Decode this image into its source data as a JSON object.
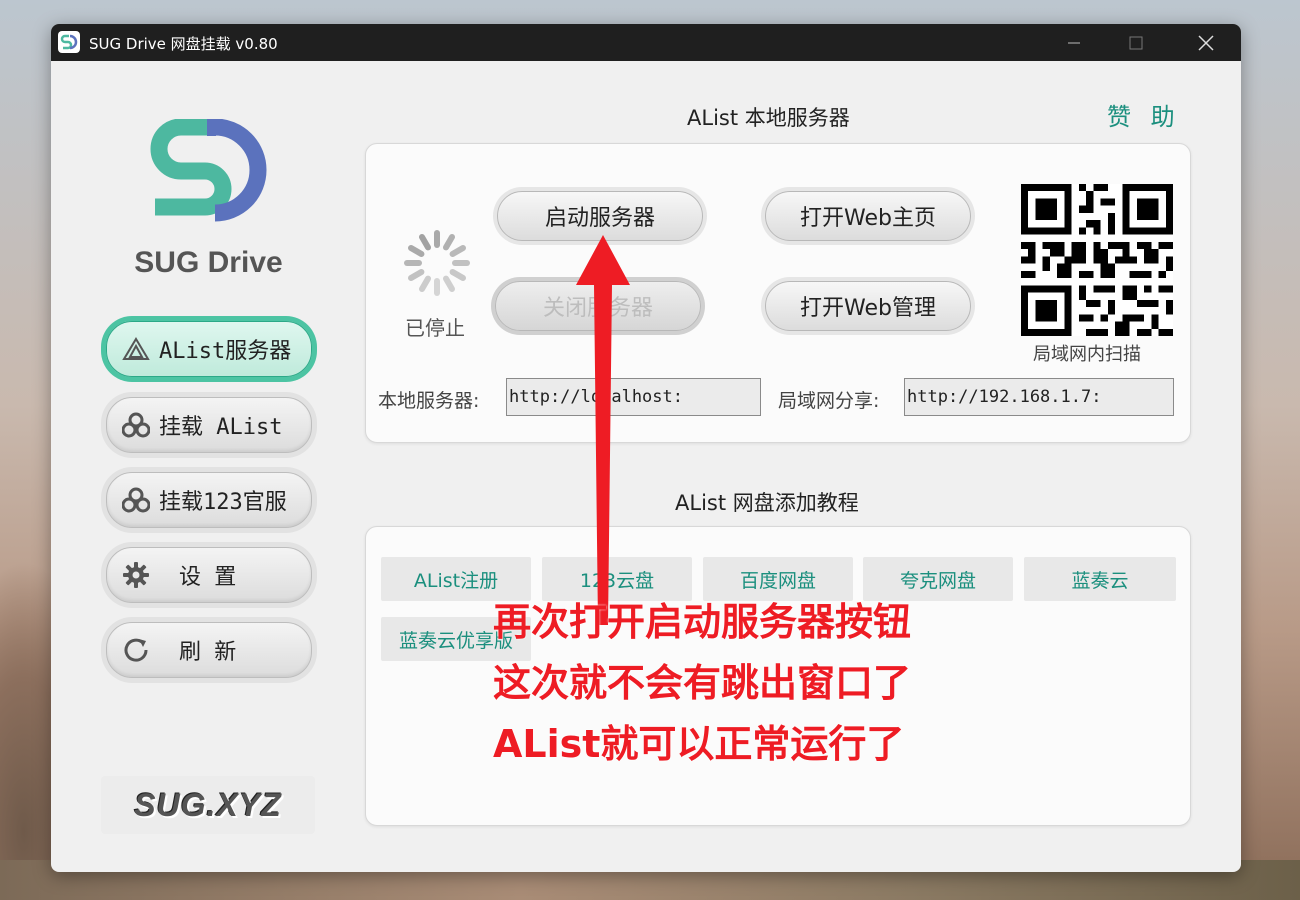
{
  "window": {
    "title": "SUG Drive 网盘挂载  v0.80",
    "app_icon_text": "SD"
  },
  "brand": {
    "logo_name": "SUG Drive",
    "accent": "#4cc4a3",
    "logo_colors": [
      "#4db8a0",
      "#5b72bd"
    ],
    "footer_logo": "SUG.XYZ"
  },
  "sidebar": {
    "items": [
      {
        "label": "AList服务器",
        "icon": "alist-icon",
        "active": true
      },
      {
        "label": "挂载 AList",
        "icon": "cloud-link-icon",
        "active": false
      },
      {
        "label": "挂载123官服",
        "icon": "cloud-link-icon",
        "active": false
      },
      {
        "label": "设 置",
        "icon": "gear-icon",
        "active": false
      },
      {
        "label": "刷 新",
        "icon": "refresh-icon",
        "active": false
      }
    ]
  },
  "server": {
    "section_title": "AList 本地服务器",
    "sponsor_label": "赞 助",
    "start_label": "启动服务器",
    "stop_label": "关闭服务器",
    "open_home_label": "打开Web主页",
    "open_admin_label": "打开Web管理",
    "status": "已停止",
    "local_label": "本地服务器:",
    "local_value": "http://localhost:",
    "lan_label": "局域网分享:",
    "lan_value": "http://192.168.1.7:",
    "qr_caption": "局域网内扫描"
  },
  "tutorial": {
    "section_title": "AList 网盘添加教程",
    "links": [
      "AList注册",
      "123云盘",
      "百度网盘",
      "夸克网盘",
      "蓝奏云",
      "蓝奏云优享版"
    ]
  },
  "annotation": {
    "lines": [
      "再次打开启动服务器按钮",
      "这次就不会有跳出窗口了",
      "AList就可以正常运行了"
    ],
    "color": "#ee1c24"
  }
}
